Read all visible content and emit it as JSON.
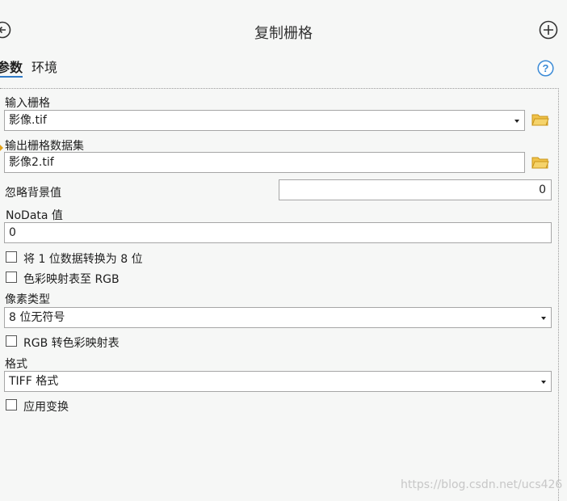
{
  "header": {
    "title": "复制栅格"
  },
  "tabs": {
    "params": "参数",
    "env": "环境"
  },
  "params": {
    "input_raster": {
      "label": "输入栅格",
      "value": "影像.tif"
    },
    "output_dataset": {
      "label": "输出栅格数据集",
      "value": "影像2.tif"
    },
    "ignore_background": {
      "label": "忽略背景值",
      "value": "0"
    },
    "nodata": {
      "label": "NoData 值",
      "value": "0"
    },
    "convert_1bit": {
      "label": "将 1 位数据转换为 8 位",
      "checked": false
    },
    "colormap_to_rgb": {
      "label": "色彩映射表至 RGB",
      "checked": false
    },
    "pixel_type": {
      "label": "像素类型",
      "value": "8 位无符号"
    },
    "rgb_to_colormap": {
      "label": "RGB 转色彩映射表",
      "checked": false
    },
    "format": {
      "label": "格式",
      "value": "TIFF 格式"
    },
    "apply_transform": {
      "label": "应用变换",
      "checked": false
    }
  },
  "watermark": "https://blog.csdn.net/ucs426",
  "colors": {
    "accent": "#2f7ac7",
    "folder": "#e3a21a",
    "background": "#f6f7f6"
  }
}
